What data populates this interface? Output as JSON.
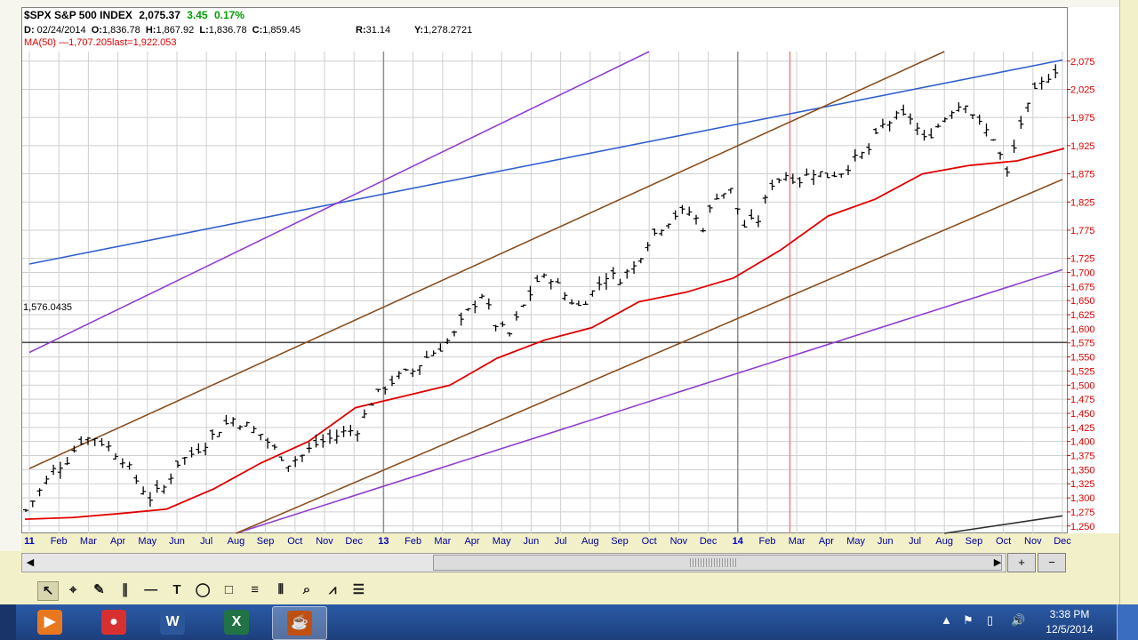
{
  "header": {
    "symbol": "$SPX S&P 500 INDEX",
    "price": "2,075.37",
    "change": "3.45",
    "change_pct": "0.17%",
    "date_label": "D:",
    "date": "02/24/2014",
    "open_label": "O:",
    "open": "1,836.78",
    "high_label": "H:",
    "high": "1,867.92",
    "low_label": "L:",
    "low": "1,836.78",
    "close_label": "C:",
    "close": "1,859.45",
    "r_label": "R:",
    "r_value": "31.14",
    "y_label": "Y:",
    "y_value": "1,278.2721",
    "ma_text": "MA(50) —1,707.205last=1,922.053",
    "change_color": "#00a000",
    "ma_color": "#e00000"
  },
  "cursor_label": "1,576.0435",
  "chart_data": {
    "type": "ohlc",
    "ylim": [
      1237,
      2092
    ],
    "y_ticks": [
      "2,075",
      "2,025",
      "1,975",
      "1,925",
      "1,875",
      "1,825",
      "1,775",
      "1,725",
      "1,700",
      "1,675",
      "1,650",
      "1,625",
      "1,600",
      "1,575",
      "1,550",
      "1,525",
      "1,500",
      "1,475",
      "1,450",
      "1,425",
      "1,400",
      "1,375",
      "1,350",
      "1,325",
      "1,300",
      "1,275",
      "1,250"
    ],
    "x_labels": [
      "11",
      "Feb",
      "Mar",
      "Apr",
      "May",
      "Jun",
      "Jul",
      "Aug",
      "Sep",
      "Oct",
      "Nov",
      "Dec",
      "13",
      "Feb",
      "Mar",
      "Apr",
      "May",
      "Jun",
      "Jul",
      "Aug",
      "Sep",
      "Oct",
      "Nov",
      "Dec",
      "14",
      "Feb",
      "Mar",
      "Apr",
      "May",
      "Jun",
      "Jul",
      "Aug",
      "Sep",
      "Oct",
      "Nov",
      "Dec"
    ],
    "year_labels": [
      "11",
      "13",
      "14"
    ],
    "x_range": [
      "Jan 2012",
      "Dec 2014"
    ],
    "price_path": [
      [
        0,
        1278
      ],
      [
        1,
        1312
      ],
      [
        2,
        1349
      ],
      [
        3,
        1368
      ],
      [
        4,
        1402
      ],
      [
        5,
        1408
      ],
      [
        6,
        1390
      ],
      [
        7,
        1370
      ],
      [
        8,
        1331
      ],
      [
        9,
        1300
      ],
      [
        10,
        1318
      ],
      [
        11,
        1362
      ],
      [
        12,
        1378
      ],
      [
        13,
        1398
      ],
      [
        14,
        1422
      ],
      [
        15,
        1440
      ],
      [
        16,
        1428
      ],
      [
        17,
        1413
      ],
      [
        18,
        1386
      ],
      [
        19,
        1362
      ],
      [
        20,
        1375
      ],
      [
        21,
        1395
      ],
      [
        22,
        1405
      ],
      [
        23,
        1416
      ],
      [
        24,
        1422
      ],
      [
        25,
        1470
      ],
      [
        26,
        1498
      ],
      [
        27,
        1515
      ],
      [
        28,
        1525
      ],
      [
        29,
        1550
      ],
      [
        30,
        1567
      ],
      [
        31,
        1590
      ],
      [
        32,
        1630
      ],
      [
        33,
        1662
      ],
      [
        34,
        1608
      ],
      [
        35,
        1590
      ],
      [
        36,
        1640
      ],
      [
        37,
        1685
      ],
      [
        38,
        1692
      ],
      [
        39,
        1660
      ],
      [
        40,
        1640
      ],
      [
        41,
        1665
      ],
      [
        42,
        1695
      ],
      [
        43,
        1690
      ],
      [
        44,
        1710
      ],
      [
        45,
        1756
      ],
      [
        46,
        1782
      ],
      [
        47,
        1803
      ],
      [
        48,
        1808
      ],
      [
        49,
        1781
      ],
      [
        50,
        1838
      ],
      [
        51,
        1845
      ],
      [
        52,
        1782
      ],
      [
        53,
        1794
      ],
      [
        54,
        1859
      ],
      [
        55,
        1874
      ],
      [
        56,
        1864
      ],
      [
        57,
        1880
      ],
      [
        58,
        1872
      ],
      [
        59,
        1879
      ],
      [
        60,
        1900
      ],
      [
        61,
        1918
      ],
      [
        62,
        1960
      ],
      [
        63,
        1975
      ],
      [
        64,
        1975
      ],
      [
        65,
        1935
      ],
      [
        66,
        1960
      ],
      [
        67,
        1990
      ],
      [
        68,
        2003
      ],
      [
        69,
        1962
      ],
      [
        70,
        1940
      ],
      [
        71,
        1874
      ],
      [
        72,
        1965
      ],
      [
        73,
        2018
      ],
      [
        74,
        2050
      ],
      [
        75,
        2072
      ]
    ],
    "ma50_path": [
      [
        0,
        1262
      ],
      [
        5,
        1265
      ],
      [
        10,
        1272
      ],
      [
        15,
        1280
      ],
      [
        20,
        1316
      ],
      [
        25,
        1362
      ],
      [
        30,
        1400
      ],
      [
        35,
        1460
      ],
      [
        40,
        1480
      ],
      [
        45,
        1500
      ],
      [
        50,
        1548
      ],
      [
        55,
        1580
      ],
      [
        60,
        1602
      ],
      [
        65,
        1648
      ],
      [
        70,
        1665
      ],
      [
        75,
        1690
      ],
      [
        80,
        1740
      ],
      [
        85,
        1800
      ],
      [
        90,
        1830
      ],
      [
        95,
        1875
      ],
      [
        100,
        1890
      ],
      [
        105,
        1898
      ],
      [
        110,
        1920
      ]
    ],
    "series": [
      {
        "name": "MA(50)",
        "color": "#e00000"
      }
    ],
    "trendlines": [
      {
        "color": "#3060d0",
        "points": [
          [
            "Jan 2012",
            1715
          ],
          [
            "Dec 2014",
            2077
          ]
        ]
      },
      {
        "color": "#9040d0",
        "points": [
          [
            "Jan 2012",
            1558
          ],
          [
            "Oct 2013",
            2092
          ]
        ]
      },
      {
        "color": "#9040d0",
        "points": [
          [
            "Aug 2012",
            1237
          ],
          [
            "Dec 2014",
            1705
          ]
        ]
      },
      {
        "color": "#8a5020",
        "points": [
          [
            "Jan 2012",
            1352
          ],
          [
            "Aug 2014",
            2092
          ]
        ]
      },
      {
        "color": "#8a5020",
        "points": [
          [
            "Aug 2012",
            1237
          ],
          [
            "Dec 2014",
            1865
          ]
        ]
      },
      {
        "color": "#303030",
        "points": [
          [
            "Aug 2014",
            1237
          ],
          [
            "Dec 2014",
            1268
          ]
        ]
      }
    ],
    "horizontal_line": 1576.0435,
    "vertical_lines": [
      {
        "at": "Jan 2013",
        "color": "#909090"
      },
      {
        "at": "Jan 2014",
        "color": "#909090"
      },
      {
        "at": "Feb 24 2014",
        "color": "#f08080"
      }
    ],
    "grid": true
  },
  "scrollbar": {
    "left_arrow": "◀",
    "right_arrow": "▶"
  },
  "zoom": {
    "in": "+",
    "out": "−"
  },
  "toolbar": {
    "tools": [
      {
        "name": "select-tool",
        "glyph": "↖"
      },
      {
        "name": "crosshair-tool",
        "glyph": "⌖"
      },
      {
        "name": "pencil-tool",
        "glyph": "✎"
      },
      {
        "name": "parallel-tool",
        "glyph": "∥"
      },
      {
        "name": "hline-tool",
        "glyph": "—"
      },
      {
        "name": "text-tool",
        "glyph": "T"
      },
      {
        "name": "ellipse-tool",
        "glyph": "◯"
      },
      {
        "name": "rect-tool",
        "glyph": "□"
      },
      {
        "name": "fib-tool",
        "glyph": "≡"
      },
      {
        "name": "cycles-tool",
        "glyph": "⦀"
      },
      {
        "name": "zoom-tool",
        "glyph": "⌕"
      },
      {
        "name": "fan-tool",
        "glyph": "⩘"
      },
      {
        "name": "lines-tool",
        "glyph": "☰"
      }
    ]
  },
  "taskbar": {
    "apps": [
      {
        "name": "media-player-icon",
        "glyph": "▶",
        "color": "#e87820"
      },
      {
        "name": "chrome-icon",
        "glyph": "●",
        "color": "#d83030"
      },
      {
        "name": "word-icon",
        "glyph": "W",
        "color": "#2b579a"
      },
      {
        "name": "excel-icon",
        "glyph": "X",
        "color": "#217346"
      },
      {
        "name": "java-icon",
        "glyph": "☕",
        "color": "#c05010"
      }
    ],
    "time": "3:38 PM",
    "date": "12/5/2014"
  }
}
